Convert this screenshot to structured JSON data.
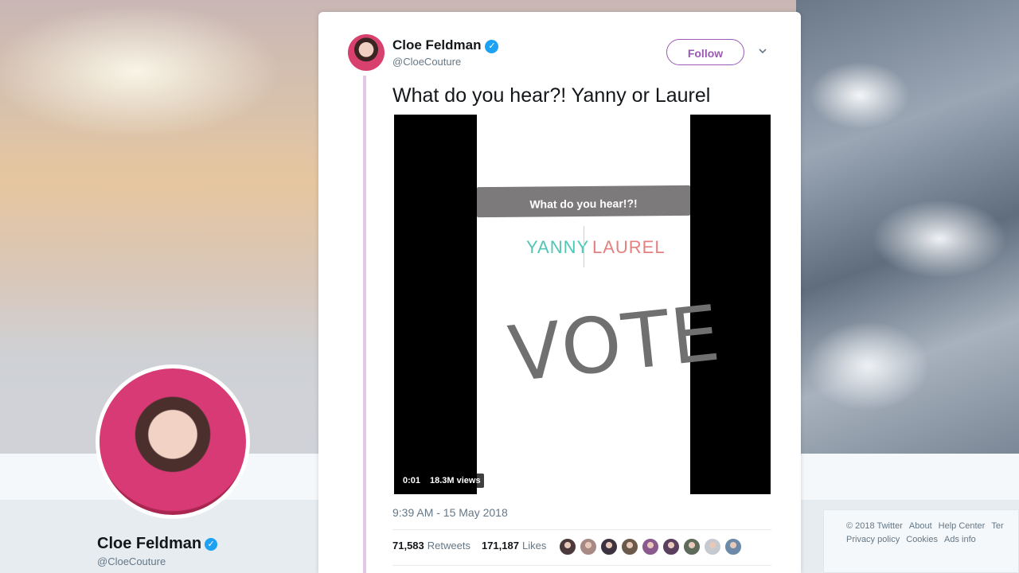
{
  "background_profile": {
    "name": "Cloe Feldman",
    "handle": "@CloeCouture",
    "verified_glyph": "✓",
    "footer_links": [
      "© 2018 Twitter",
      "About",
      "Help Center",
      "Ter",
      "Privacy policy",
      "Cookies",
      "Ads info"
    ]
  },
  "tweet": {
    "author_name": "Cloe Feldman",
    "author_handle": "@CloeCouture",
    "verified_glyph": "✓",
    "follow_label": "Follow",
    "text": "What do you hear?! Yanny or Laurel",
    "media": {
      "question": "What do you hear!?!",
      "option_a": "YANNY",
      "option_b": "LAUREL",
      "cta": "VOTE",
      "timer": "0:01",
      "views": "18.3M views"
    },
    "timestamp": "9:39 AM - 15 May 2018",
    "retweets_count": "71,583",
    "retweets_label": "Retweets",
    "likes_count": "171,187",
    "likes_label": "Likes"
  },
  "colors": {
    "accent": "#9b59b6",
    "verified": "#1da1f2",
    "thread_line": "#e3c6e8",
    "yanny": "#4fc6b8",
    "laurel": "#e58080"
  },
  "liker_avatar_colors": [
    "#4a3a3c",
    "#a78a84",
    "#3d3340",
    "#6b5a4c",
    "#8a5a8e",
    "#5a3f5e",
    "#5e6a5a",
    "#c4cad0",
    "#6c8aa8"
  ]
}
